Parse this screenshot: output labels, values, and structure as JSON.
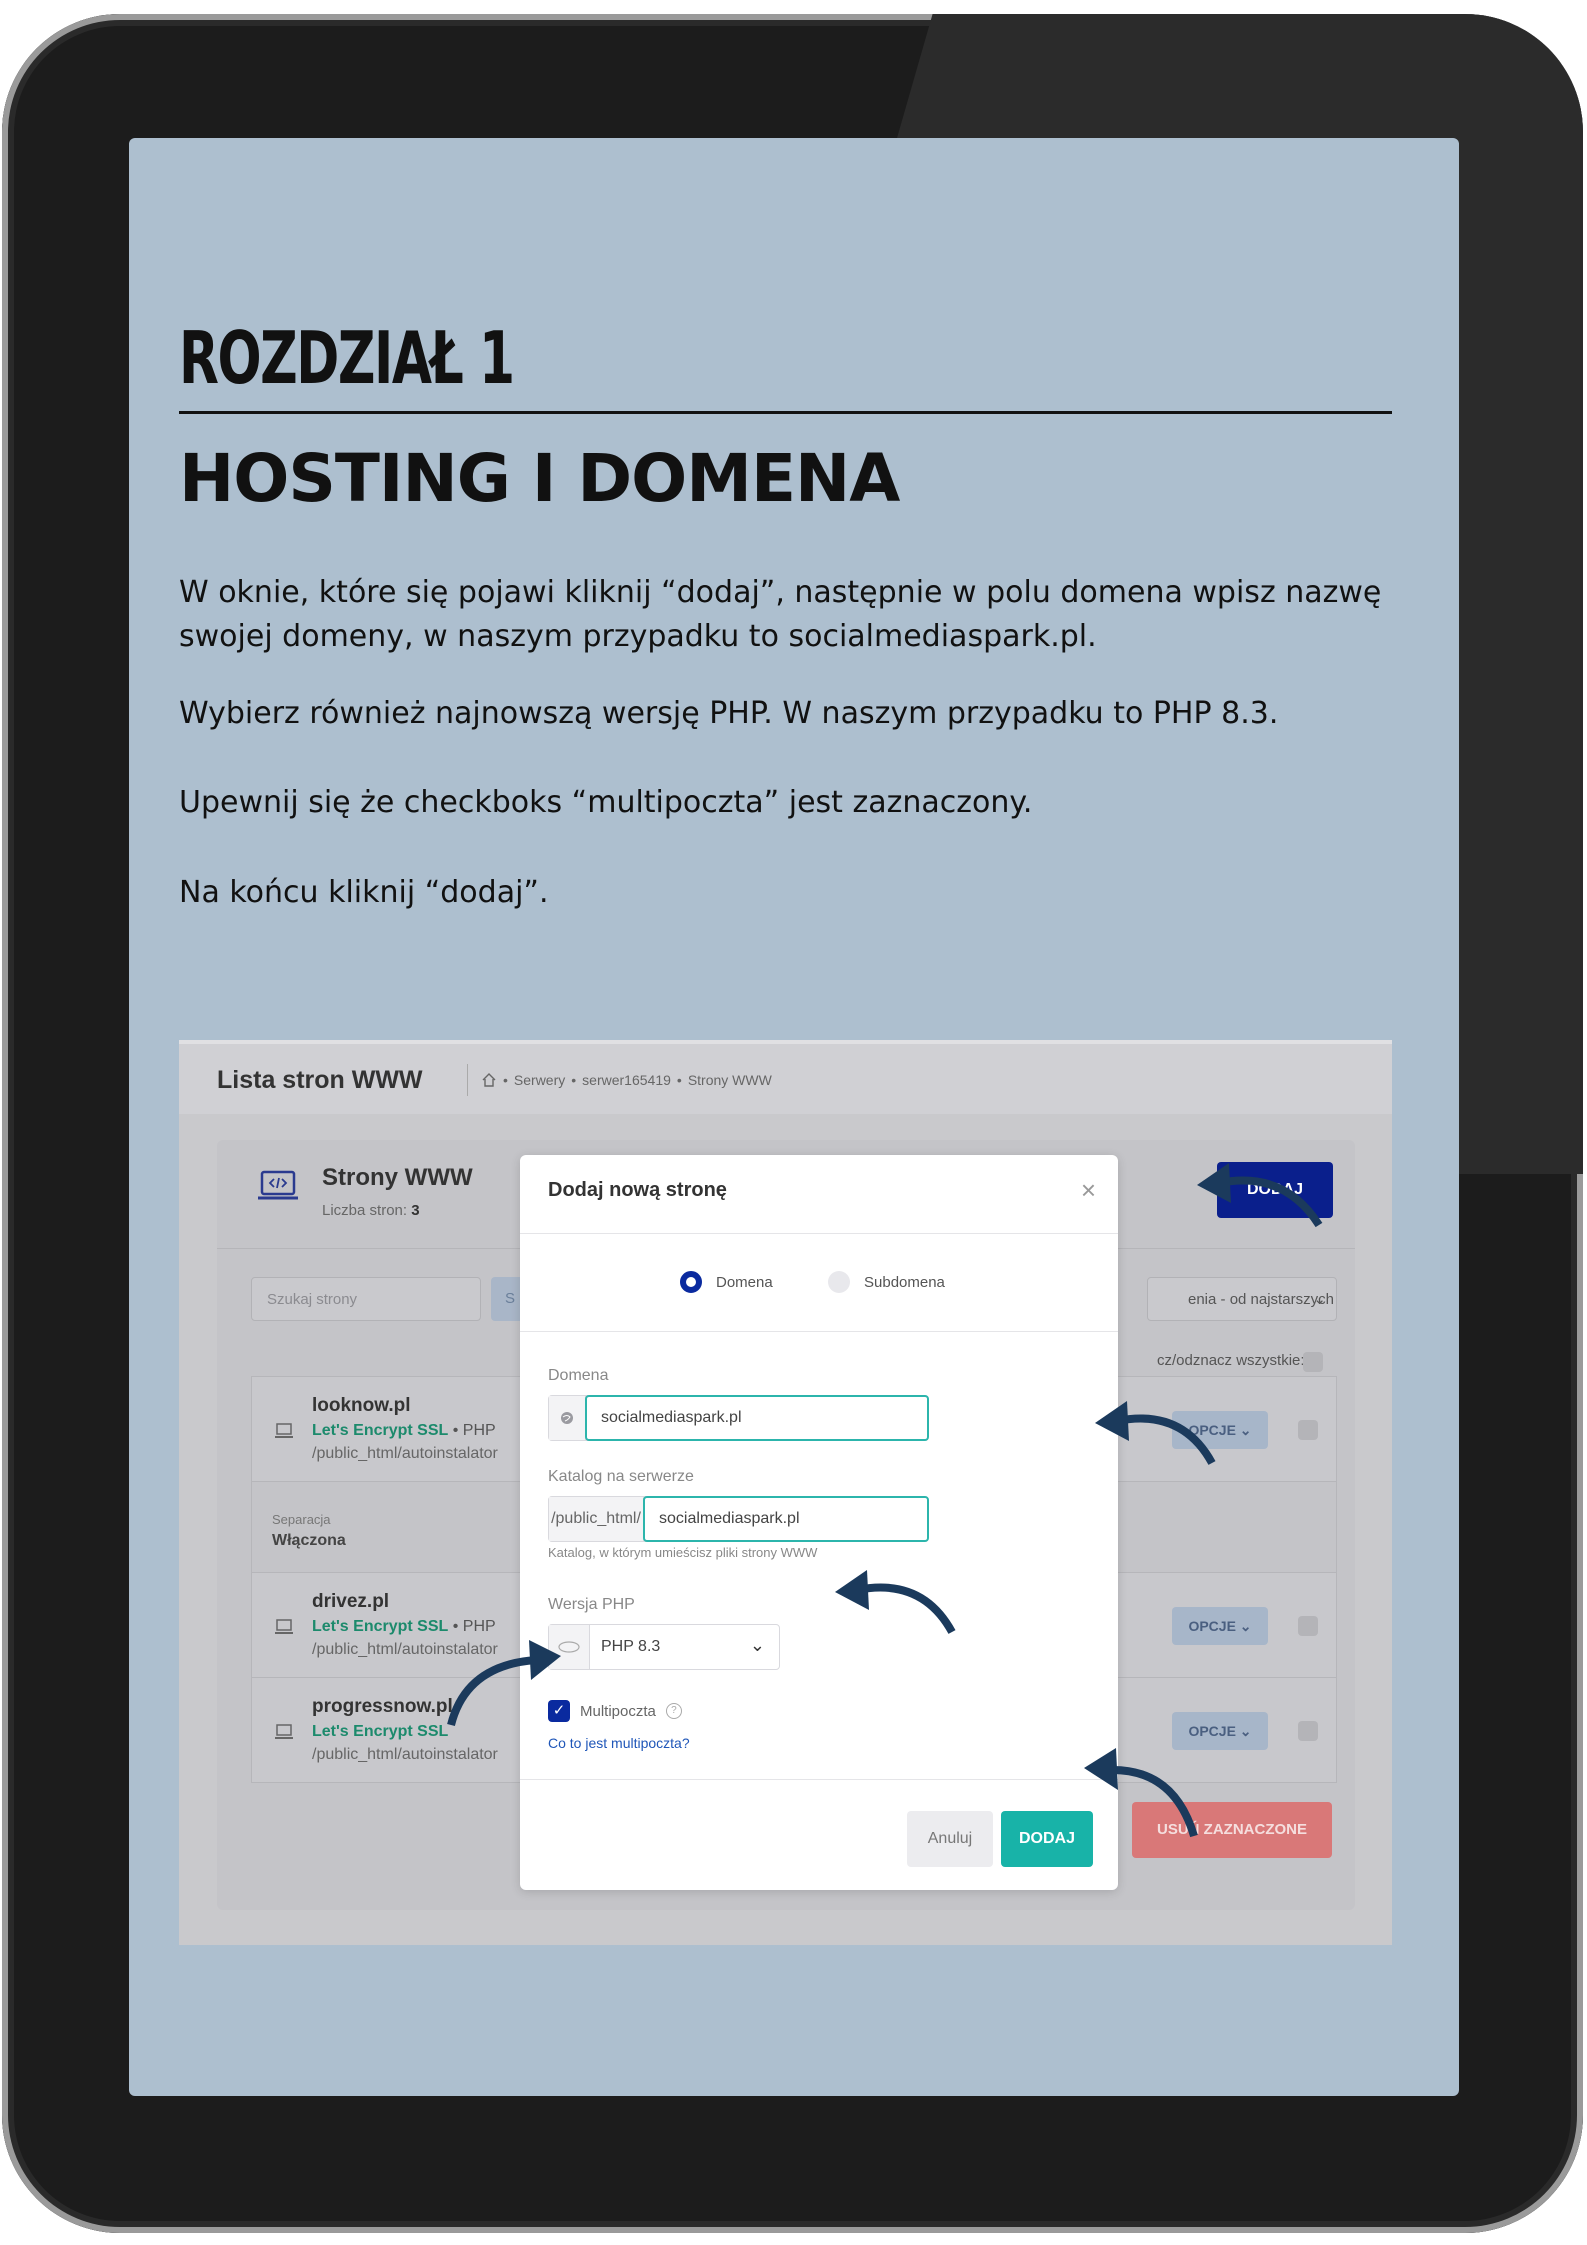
{
  "page": {
    "chapter": "ROZDZIAŁ 1",
    "headline": "HOSTING I DOMENA",
    "paragraphs": [
      "W oknie, które się pojawi kliknij “dodaj”, następnie w polu domena wpisz nazwę swojej domeny, w naszym przypadku to socialmediaspark.pl.",
      "Wybierz również najnowszą wersję PHP. W naszym przypadku to PHP 8.3.",
      "Upewnij się że checkboks “multipoczta” jest zaznaczony.",
      "Na końcu kliknij “dodaj”."
    ]
  },
  "screenshot": {
    "header_title": "Lista stron WWW",
    "breadcrumb": [
      "Serwery",
      "serwer165419",
      "Strony WWW"
    ],
    "panel_title": "Strony WWW",
    "count_label": "Liczba stron:",
    "count_value": "3",
    "add_button": "DODAJ",
    "search_placeholder": "Szukaj strony",
    "search_button": "S",
    "sort_value": "enia - od najstarszych",
    "select_all_label": "cz/odznacz wszystkie:",
    "options_label": "OPCJE",
    "delete_button": "USUŃ ZAZNACZONE",
    "sites": [
      {
        "name": "looknow.pl",
        "ssl": "Let's Encrypt SSL",
        "php": "PHP",
        "path": "/public_html/autoinstalator"
      },
      {
        "name": "drivez.pl",
        "ssl": "Let's Encrypt SSL",
        "php": "PHP",
        "path": "/public_html/autoinstalator"
      },
      {
        "name": "progressnow.pl",
        "ssl": "Let's Encrypt SSL",
        "php": "",
        "path": "/public_html/autoinstalator"
      }
    ],
    "separation": {
      "label": "Separacja",
      "value": "Włączona"
    }
  },
  "modal": {
    "title": "Dodaj nową stronę",
    "radio_domain": "Domena",
    "radio_subdomain": "Subdomena",
    "domain_label": "Domena",
    "domain_value": "socialmediaspark.pl",
    "dir_label": "Katalog na serwerze",
    "dir_prefix": "/public_html/",
    "dir_value": "socialmediaspark.pl",
    "dir_hint": "Katalog, w którym umieścisz pliki strony WWW",
    "php_label": "Wersja PHP",
    "php_value": "PHP 8.3",
    "multi_label": "Multipoczta",
    "multi_link": "Co to jest multipoczta?",
    "cancel": "Anuluj",
    "confirm": "DODAJ"
  },
  "colors": {
    "screen_bg": "#adbfcf",
    "arrow": "#1b3a5c",
    "primary_blue": "#0a1f8c",
    "teal": "#18b3a8",
    "ssl_green": "#1c8a6c"
  },
  "icons": [
    "home-icon",
    "laptop-code-icon",
    "globe-icon",
    "php-icon",
    "close-icon",
    "chevron-down-icon",
    "help-icon",
    "check-icon",
    "curved-arrow-icon"
  ]
}
